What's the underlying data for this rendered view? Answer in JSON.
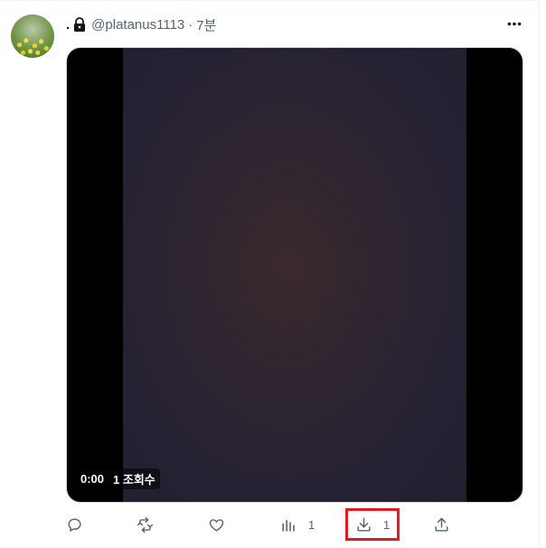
{
  "tweet": {
    "author": {
      "display_name": ".",
      "handle": "@platanus1113",
      "separator": "·",
      "time": "7분",
      "protected_icon": "lock-icon"
    },
    "more_icon": "more-horizontal-icon",
    "video": {
      "timestamp": "0:00",
      "views": "1 조회수"
    },
    "actions": {
      "reply": {
        "icon": "reply-icon",
        "count": ""
      },
      "retweet": {
        "icon": "retweet-icon",
        "count": ""
      },
      "like": {
        "icon": "heart-icon",
        "count": ""
      },
      "views": {
        "icon": "analytics-icon",
        "count": "1"
      },
      "download": {
        "icon": "download-icon",
        "count": "1"
      },
      "share": {
        "icon": "share-icon",
        "count": ""
      }
    }
  },
  "colors": {
    "secondary_text": "#536471",
    "highlight": "#e11b22",
    "video_bg": "#262132"
  }
}
